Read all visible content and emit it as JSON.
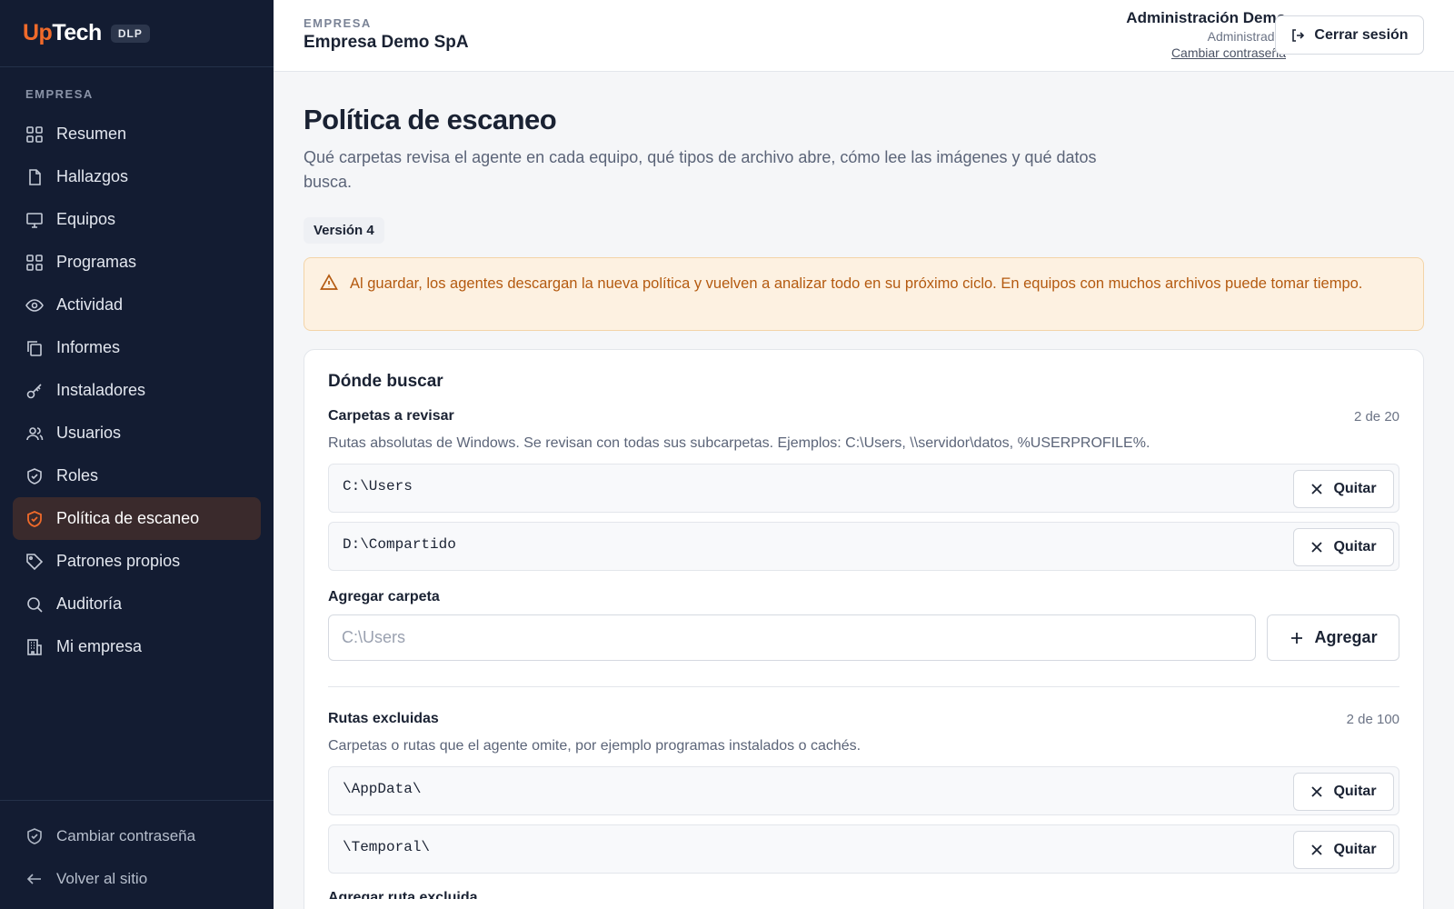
{
  "brand": {
    "up": "Up",
    "tech": "Tech",
    "tag": "DLP"
  },
  "sidebar": {
    "section": "EMPRESA",
    "items": [
      {
        "label": "Resumen",
        "icon": "grid-icon"
      },
      {
        "label": "Hallazgos",
        "icon": "file-icon"
      },
      {
        "label": "Equipos",
        "icon": "monitor-icon"
      },
      {
        "label": "Programas",
        "icon": "apps-icon"
      },
      {
        "label": "Actividad",
        "icon": "eye-icon"
      },
      {
        "label": "Informes",
        "icon": "copy-icon"
      },
      {
        "label": "Instaladores",
        "icon": "key-icon"
      },
      {
        "label": "Usuarios",
        "icon": "users-icon"
      },
      {
        "label": "Roles",
        "icon": "shield-check-icon"
      },
      {
        "label": "Política de escaneo",
        "icon": "shield-icon",
        "active": true
      },
      {
        "label": "Patrones propios",
        "icon": "tag-icon"
      },
      {
        "label": "Auditoría",
        "icon": "search-icon"
      },
      {
        "label": "Mi empresa",
        "icon": "building-icon"
      }
    ],
    "bottom": [
      {
        "label": "Cambiar contraseña",
        "icon": "shield-check-icon"
      },
      {
        "label": "Volver al sitio",
        "icon": "arrow-left-icon"
      }
    ]
  },
  "header": {
    "company_label": "EMPRESA",
    "company_name": "Empresa Demo SpA",
    "user_name": "Administración Demo",
    "user_role": "Administrador",
    "change_password": "Cambiar contraseña",
    "logout": "Cerrar sesión"
  },
  "page": {
    "title": "Política de escaneo",
    "description": "Qué carpetas revisa el agente en cada equipo, qué tipos de archivo abre, cómo lee las imágenes y qué datos busca.",
    "version": "Versión 4",
    "alert": "Al guardar, los agentes descargan la nueva política y vuelven a analizar todo en su próximo ciclo. En equipos con muchos archivos puede tomar tiempo."
  },
  "card": {
    "title": "Dónde buscar",
    "folders": {
      "label": "Carpetas a revisar",
      "count": "2 de 20",
      "help": "Rutas absolutas de Windows. Se revisan con todas sus subcarpetas. Ejemplos: C:\\Users, \\\\servidor\\datos, %USERPROFILE%.",
      "paths": [
        "C:\\Users",
        "D:\\Compartido"
      ],
      "remove_label": "Quitar"
    },
    "add_folder": {
      "label": "Agregar carpeta",
      "placeholder": "C:\\Users",
      "button": "Agregar"
    },
    "excluded": {
      "label": "Rutas excluidas",
      "count": "2 de 100",
      "help": "Carpetas o rutas que el agente omite, por ejemplo programas instalados o cachés.",
      "paths": [
        "\\AppData\\",
        "\\Temporal\\"
      ],
      "remove_label": "Quitar"
    },
    "next_section_partial": "Agregar ruta excluida"
  }
}
